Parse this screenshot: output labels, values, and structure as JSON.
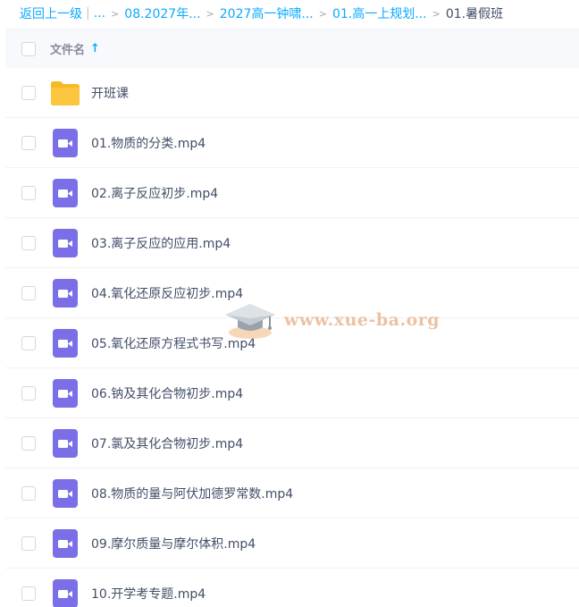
{
  "breadcrumb": {
    "back_label": "返回上一级",
    "pipe": "|",
    "ellipsis": "...",
    "items": [
      "08.2027年...",
      "2027高一钟啸...",
      "01.高一上规划..."
    ],
    "current": "01.暑假班"
  },
  "header": {
    "filename_label": "文件名",
    "sort_icon": "arrow-up-icon",
    "sort_glyph": "↑"
  },
  "files": [
    {
      "name": "开班课",
      "type": "folder"
    },
    {
      "name": "01.物质的分类.mp4",
      "type": "video"
    },
    {
      "name": "02.离子反应初步.mp4",
      "type": "video"
    },
    {
      "name": "03.离子反应的应用.mp4",
      "type": "video"
    },
    {
      "name": "04.氧化还原反应初步.mp4",
      "type": "video"
    },
    {
      "name": "05.氧化还原方程式书写.mp4",
      "type": "video"
    },
    {
      "name": "06.钠及其化合物初步.mp4",
      "type": "video"
    },
    {
      "name": "07.氯及其化合物初步.mp4",
      "type": "video"
    },
    {
      "name": "08.物质的量与阿伏加德罗常数.mp4",
      "type": "video"
    },
    {
      "name": "09.摩尔质量与摩尔体积.mp4",
      "type": "video"
    },
    {
      "name": "10.开学考专题.mp4",
      "type": "video"
    }
  ],
  "watermark": {
    "text": "www.xue-ba.org",
    "icon": "graduation-cap-icon"
  },
  "colors": {
    "link": "#09aaff",
    "folder": "#fcc63e",
    "video": "#7b6fe8",
    "text": "#424e67",
    "header_bg": "#f7f9fd"
  }
}
